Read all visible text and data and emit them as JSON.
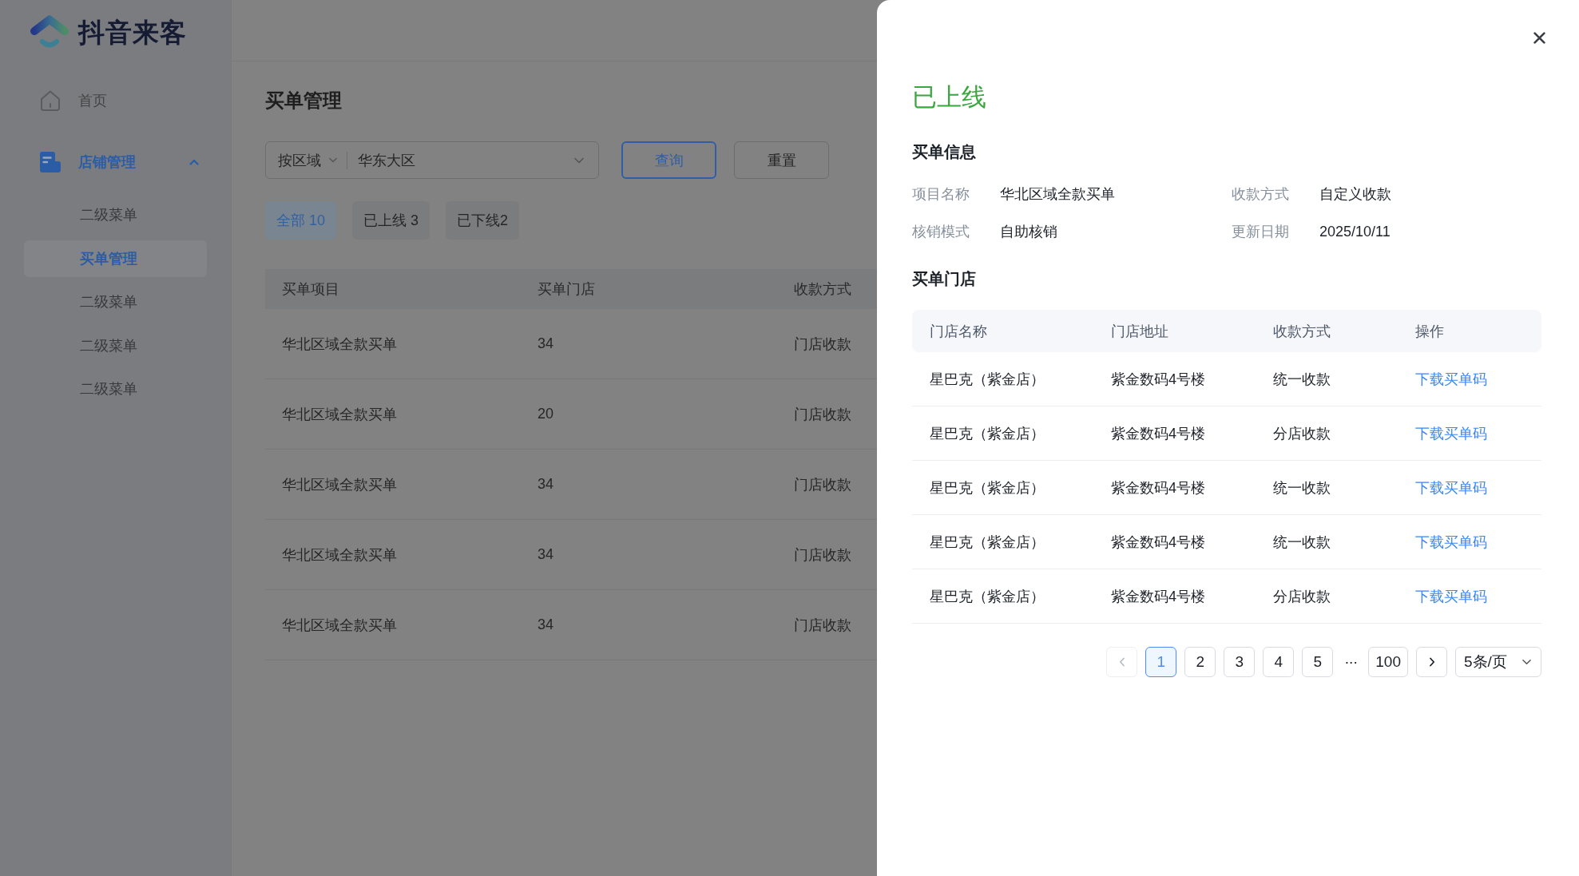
{
  "sidebar": {
    "logo_text": "抖音来客",
    "items": [
      {
        "label": "首页",
        "selected": false
      },
      {
        "label": "店铺管理",
        "selected": true,
        "expanded": true,
        "children": [
          {
            "label": "二级菜单",
            "selected": false
          },
          {
            "label": "买单管理",
            "selected": true
          },
          {
            "label": "二级菜单",
            "selected": false
          },
          {
            "label": "二级菜单",
            "selected": false
          },
          {
            "label": "二级菜单",
            "selected": false
          }
        ]
      }
    ]
  },
  "page": {
    "title": "买单管理",
    "filter": {
      "scope": "按区域",
      "region": "华东大区"
    },
    "buttons": [
      {
        "label": "查询",
        "kind": "primary"
      },
      {
        "label": "重置",
        "kind": "default"
      }
    ],
    "status_tabs": [
      {
        "label": "全部 10",
        "selected": true
      },
      {
        "label": "已上线 3",
        "selected": false
      },
      {
        "label": "已下线2",
        "selected": false
      }
    ],
    "table": {
      "columns": [
        "买单项目",
        "买单门店",
        "收款方式"
      ],
      "rows": [
        [
          "华北区域全款买单",
          "34",
          "门店收款"
        ],
        [
          "华北区域全款买单",
          "20",
          "门店收款"
        ],
        [
          "华北区域全款买单",
          "34",
          "门店收款"
        ],
        [
          "华北区域全款买单",
          "34",
          "门店收款"
        ],
        [
          "华北区域全款买单",
          "34",
          "门店收款"
        ]
      ]
    }
  },
  "drawer": {
    "status": "已上线",
    "info_title": "买单信息",
    "info": [
      {
        "label": "项目名称",
        "value": "华北区域全款买单"
      },
      {
        "label": "收款方式",
        "value": "自定义收款"
      },
      {
        "label": "核销模式",
        "value": "自助核销"
      },
      {
        "label": "更新日期",
        "value": "2025/10/11"
      }
    ],
    "stores_title": "买单门店",
    "stores_table": {
      "columns": [
        "门店名称",
        "门店地址",
        "收款方式",
        "操作"
      ],
      "rows": [
        {
          "cells": [
            "星巴克（紫金店）",
            "紫金数码4号楼",
            "统一收款"
          ],
          "action": "下载买单码"
        },
        {
          "cells": [
            "星巴克（紫金店）",
            "紫金数码4号楼",
            "分店收款"
          ],
          "action": "下载买单码"
        },
        {
          "cells": [
            "星巴克（紫金店）",
            "紫金数码4号楼",
            "统一收款"
          ],
          "action": "下载买单码"
        },
        {
          "cells": [
            "星巴克（紫金店）",
            "紫金数码4号楼",
            "统一收款"
          ],
          "action": "下载买单码"
        },
        {
          "cells": [
            "星巴克（紫金店）",
            "紫金数码4号楼",
            "分店收款"
          ],
          "action": "下载买单码"
        }
      ]
    },
    "pagination": {
      "prev": {
        "disabled": true
      },
      "items": [
        {
          "kind": "page",
          "label": "1",
          "selected": true
        },
        {
          "kind": "page",
          "label": "2",
          "selected": false
        },
        {
          "kind": "page",
          "label": "3",
          "selected": false
        },
        {
          "kind": "page",
          "label": "4",
          "selected": false
        },
        {
          "kind": "page",
          "label": "5",
          "selected": false
        },
        {
          "kind": "ellipsis",
          "label": "···"
        },
        {
          "kind": "page",
          "label": "100",
          "selected": false
        }
      ],
      "next": {
        "disabled": false
      },
      "page_size": "5条/页"
    }
  }
}
